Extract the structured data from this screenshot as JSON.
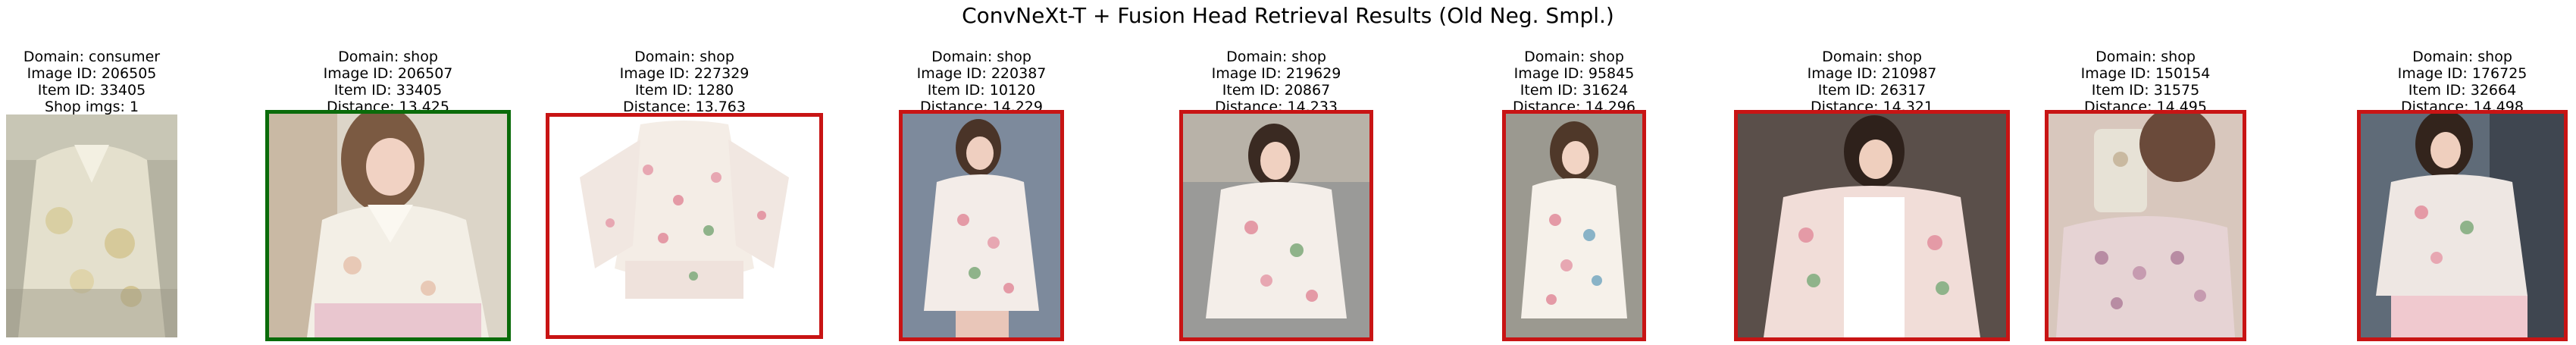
{
  "title": "ConvNeXt-T + Fusion Head Retrieval Results (Old Neg. Smpl.)",
  "colors": {
    "correct": "#0a6b0a",
    "incorrect": "#c81414"
  },
  "query": {
    "domain": "Domain: consumer",
    "image_id": "Image ID: 206505",
    "item_id": "Item ID: 33405",
    "shop_imgs": "Shop imgs: 1"
  },
  "results": [
    {
      "domain": "Domain: shop",
      "image_id": "Image ID: 206507",
      "item_id": "Item ID: 33405",
      "distance": "Distance: 13.425",
      "match": true
    },
    {
      "domain": "Domain: shop",
      "image_id": "Image ID: 227329",
      "item_id": "Item ID: 1280",
      "distance": "Distance: 13.763",
      "match": false
    },
    {
      "domain": "Domain: shop",
      "image_id": "Image ID: 220387",
      "item_id": "Item ID: 10120",
      "distance": "Distance: 14.229",
      "match": false
    },
    {
      "domain": "Domain: shop",
      "image_id": "Image ID: 219629",
      "item_id": "Item ID: 20867",
      "distance": "Distance: 14.233",
      "match": false
    },
    {
      "domain": "Domain: shop",
      "image_id": "Image ID: 95845",
      "item_id": "Item ID: 31624",
      "distance": "Distance: 14.296",
      "match": false
    },
    {
      "domain": "Domain: shop",
      "image_id": "Image ID: 210987",
      "item_id": "Item ID: 26317",
      "distance": "Distance: 14.321",
      "match": false
    },
    {
      "domain": "Domain: shop",
      "image_id": "Image ID: 150154",
      "item_id": "Item ID: 31575",
      "distance": "Distance: 14.495",
      "match": false
    },
    {
      "domain": "Domain: shop",
      "image_id": "Image ID: 176725",
      "item_id": "Item ID: 32664",
      "distance": "Distance: 14.498",
      "match": false
    }
  ]
}
